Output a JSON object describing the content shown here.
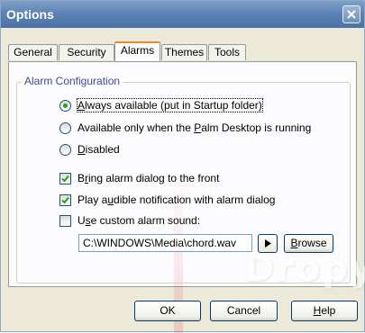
{
  "window": {
    "title": "Options"
  },
  "tabs": [
    {
      "label": "General",
      "active": false
    },
    {
      "label": "Security",
      "active": false
    },
    {
      "label": "Alarms",
      "active": true
    },
    {
      "label": "Themes",
      "active": false
    },
    {
      "label": "Tools",
      "active": false
    }
  ],
  "alarm_config": {
    "group_label": "Alarm Configuration",
    "radios": [
      {
        "pre": "",
        "mnemonic": "A",
        "post": "lways available (put in Startup folder)",
        "selected": true
      },
      {
        "pre": "Available only when the ",
        "mnemonic": "P",
        "post": "alm Desktop is running",
        "selected": false
      },
      {
        "pre": "",
        "mnemonic": "D",
        "post": "isabled",
        "selected": false
      }
    ],
    "checkboxes": [
      {
        "pre": "B",
        "mnemonic": "r",
        "post": "ing alarm dialog to the front",
        "checked": true
      },
      {
        "pre": "Play a",
        "mnemonic": "u",
        "post": "dible notification with alarm dialog",
        "checked": true
      },
      {
        "pre": "U",
        "mnemonic": "s",
        "post": "e custom alarm sound:",
        "checked": false
      }
    ],
    "sound_path": "C:\\WINDOWS\\Media\\chord.wav",
    "browse_label": {
      "mnemonic": "B",
      "post": "rowse"
    }
  },
  "buttons": {
    "ok": "OK",
    "cancel": "Cancel",
    "help": {
      "mnemonic": "H",
      "post": "elp"
    }
  },
  "watermark": "Dropy",
  "colors": {
    "title_bar": "#5d83b3",
    "active_tab_accent": "#e68b2c",
    "radio_dot": "#21a121"
  }
}
